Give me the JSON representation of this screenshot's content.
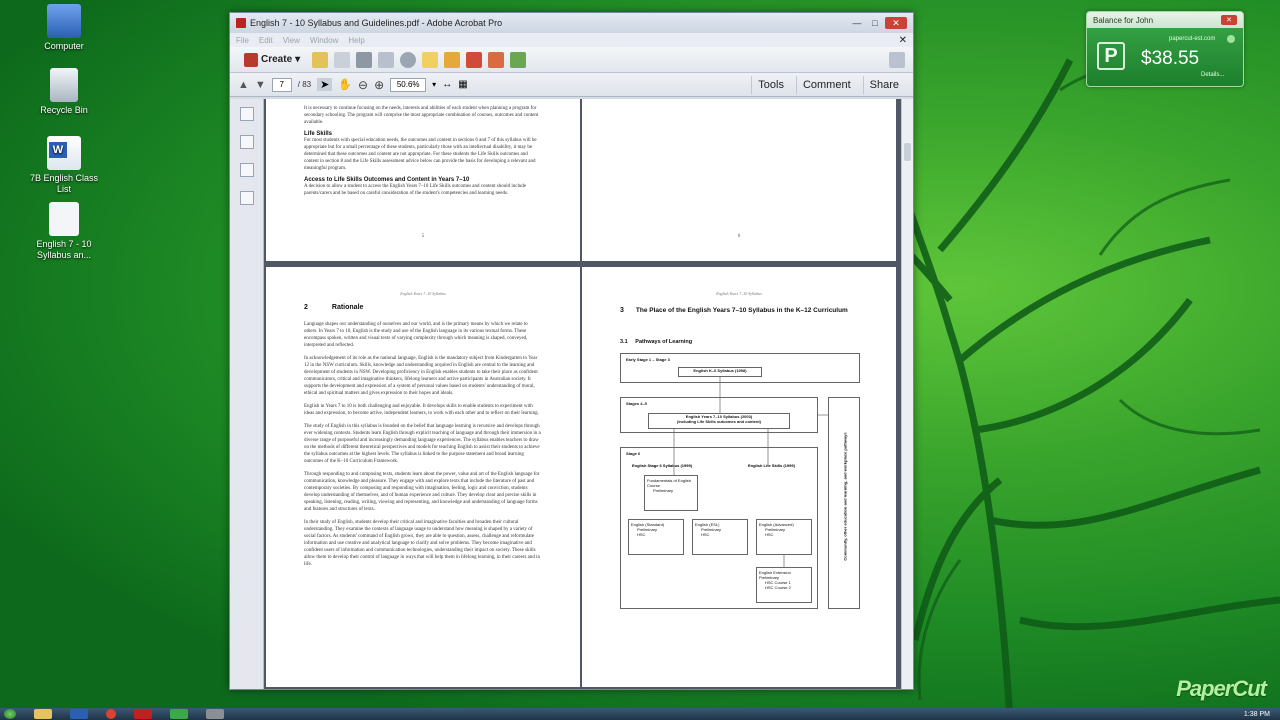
{
  "desktop": {
    "icons": [
      {
        "label": "Computer",
        "icon": "computer-icon",
        "color": "#3a6fd8"
      },
      {
        "label": "Recycle Bin",
        "icon": "recycle-bin-icon",
        "color": "#cfd8df"
      },
      {
        "label": "7B English Class List",
        "icon": "word-doc-icon",
        "color": "#2b5fb3"
      },
      {
        "label": "English 7 - 10 Syllabus an...",
        "icon": "pdf-doc-icon",
        "color": "#e9edf2"
      }
    ]
  },
  "window": {
    "title": "English 7 - 10 Syllabus and Guidelines.pdf - Adobe Acrobat Pro",
    "menu": [
      "File",
      "Edit",
      "View",
      "Window",
      "Help"
    ],
    "create_label": "Create",
    "page_current": "7",
    "page_total": "/ 83",
    "zoom": "50.6%",
    "tools_label": "Tools",
    "comment_label": "Comment",
    "share_label": "Share"
  },
  "pages": {
    "top_left": {
      "para1": "It is necessary to continue focusing on the needs, interests and abilities of each student when planning a program for secondary schooling. The program will comprise the most appropriate combination of courses, outcomes and content available.",
      "heading1": "Life Skills",
      "para2": "For most students with special education needs, the outcomes and content in sections 6 and 7 of this syllabus will be appropriate but for a small percentage of these students, particularly those with an intellectual disability, it may be determined that these outcomes and content are not appropriate. For these students the Life Skills outcomes and content in section 8 and the Life Skills assessment advice below can provide the basis for developing a relevant and meaningful program.",
      "heading2": "Access to Life Skills Outcomes and Content in Years 7–10",
      "para3": "A decision to allow a student to access the English Years 7–10 Life Skills outcomes and content should include parents/carers and be based on careful consideration of the student's competencies and learning needs.",
      "page_no": "5"
    },
    "top_right": {
      "page_no": "6"
    },
    "left": {
      "running_head": "English Years 7–10 Syllabus",
      "section": "2",
      "heading": "Rationale",
      "paras": [
        "Language shapes our understanding of ourselves and our world, and is the primary means by which we relate to others. In Years 7 to 10, English is the study and use of the English language in its various textual forms. These encompass spoken, written and visual texts of varying complexity through which meaning is shaped, conveyed, interpreted and reflected.",
        "In acknowledgement of its role as the national language, English is the mandatory subject from Kindergarten to Year 12 in the NSW curriculum. Skills, knowledge and understanding acquired in English are central to the learning and development of students in NSW. Developing proficiency in English enables students to take their place as confident communicators, critical and imaginative thinkers, lifelong learners and active participants in Australian society. It supports the development and expression of a system of personal values based on students' understanding of moral, ethical and spiritual matters and gives expression to their hopes and ideals.",
        "English in Years 7 to 10 is both challenging and enjoyable. It develops skills to enable students to experiment with ideas and expression, to become active, independent learners, to work with each other and to reflect on their learning.",
        "The study of English in this syllabus is founded on the belief that language learning is recursive and develops through ever widening contexts. Students learn English through explicit teaching of language and through their immersion in a diverse range of purposeful and increasingly demanding language experiences. The syllabus enables teachers to draw on the methods of different theoretical perspectives and models for teaching English to assist their students to achieve the syllabus outcomes at the highest levels. The syllabus is linked to the purpose statement and broad learning outcomes of the K–10 Curriculum Framework.",
        "Through responding to and composing texts, students learn about the power, value and art of the English language for communication, knowledge and pleasure. They engage with and explore texts that include the literature of past and contemporary societies. By composing and responding with imagination, feeling, logic and conviction, students develop understanding of themselves, and of human experience and culture. They develop clear and precise skills in speaking, listening, reading, writing, viewing and representing, and knowledge and understanding of language forms and features and structures of texts.",
        "In their study of English, students develop their critical and imaginative faculties and broaden their cultural understanding. They examine the contexts of language usage to understand how meaning is shaped by a variety of social factors. As students' command of English grows, they are able to question, assess, challenge and reformulate information and use creative and analytical language to clarify and solve problems. They become imaginative and confident users of information and communication technologies, understanding their impact on society. These skills allow them to develop their control of language in ways that will help them in lifelong learning, in their careers and in life."
      ]
    },
    "right": {
      "running_head": "English Years 7–10 Syllabus",
      "section": "3",
      "heading": "The Place of the English Years 7–10 Syllabus in the K–12 Curriculum",
      "subheading": "3.1     Pathways of Learning",
      "diagram": {
        "early_stage": "Early Stage 1 – Stage 3",
        "k6": "English K–6 Syllabus (1998)",
        "stages45": "Stages 4–5",
        "syllabus": "English Years 7–10 Syllabus (2003)",
        "syllabus_sub": "(including Life Skills outcomes and content)",
        "stage6": "Stage 6",
        "stage6_syl": "English Stage 6 Syllabus (1999)",
        "stage6_life": "English Life Skills (1999)",
        "fundamentals": "Fundamentals of English Course",
        "fundamentals_item": "Preliminary",
        "standard": "English (Standard)",
        "esl": "English (ESL)",
        "advanced": "English (Advanced)",
        "extension": "English Extension",
        "prelim": "Preliminary",
        "hsc": "HSC",
        "hsc1": "HSC Course 1",
        "hsc2": "HSC Course 2",
        "side": "Community, other education and learning, and workplace pathways"
      }
    }
  },
  "papercut": {
    "title": "Balance for John",
    "site": "papercut-est.com",
    "balance": "$38.55",
    "details": "Details...",
    "brand": "PaperCut"
  },
  "taskbar": {
    "clock": "1:38 PM"
  }
}
